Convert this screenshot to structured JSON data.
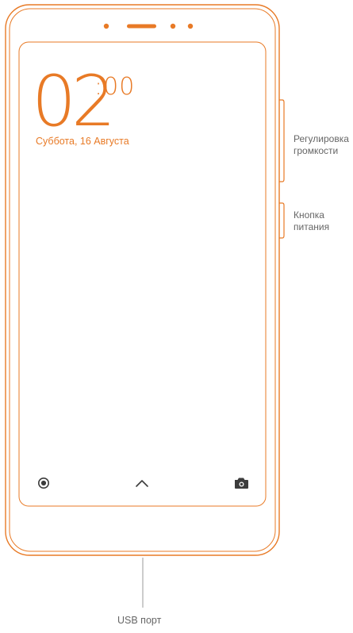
{
  "screen": {
    "time_hours": "02",
    "time_separator_minutes": ":00",
    "date": "Суббота, 16 Августа"
  },
  "nav": {
    "left_icon": "record-circle-icon",
    "center_icon": "chevron-up-icon",
    "right_icon": "camera-icon"
  },
  "callouts": {
    "volume": "Регулировка громкости",
    "power": "Кнопка питания",
    "usb": "USB порт"
  },
  "colors": {
    "accent": "#E87A26",
    "label": "#666666",
    "leader_line": "#999999"
  }
}
